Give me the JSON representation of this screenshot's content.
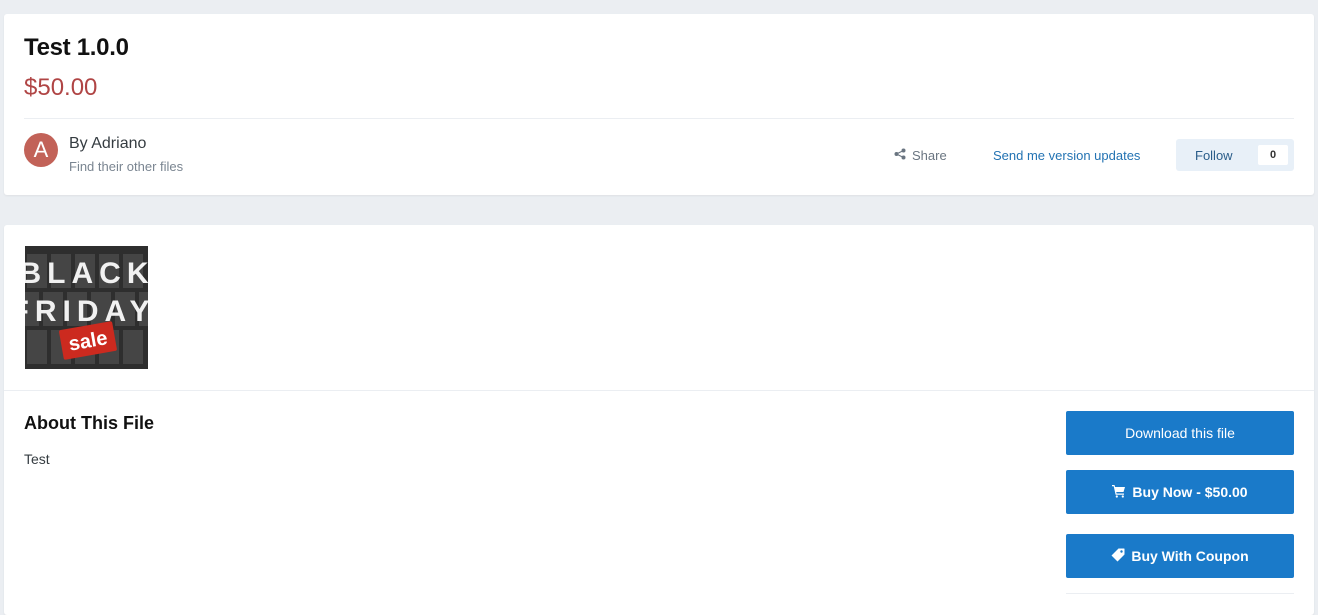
{
  "file": {
    "title": "Test 1.0.0",
    "price": "$50.00"
  },
  "author": {
    "initial": "A",
    "by_label": "By Adriano",
    "other_files": "Find their other files",
    "avatar_color": "#c26258"
  },
  "actions": {
    "share": "Share",
    "version_updates": "Send me version updates",
    "follow": "Follow",
    "follow_count": "0"
  },
  "thumbnail": {
    "line1": "BLACK",
    "line2": "FRIDAY",
    "tag": "sale"
  },
  "about": {
    "heading": "About This File",
    "text": "Test"
  },
  "buttons": {
    "download": "Download this file",
    "buy_now": "Buy Now - $50.00",
    "buy_coupon": "Buy With Coupon"
  },
  "colors": {
    "accent": "#1a7ac9",
    "price": "#b04545",
    "link": "#2373b3"
  }
}
